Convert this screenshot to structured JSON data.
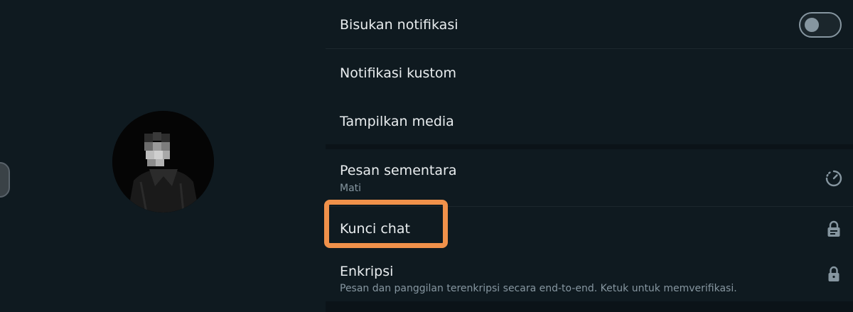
{
  "colors": {
    "background": "#0f1a20",
    "text_primary": "#e9edef",
    "text_secondary": "#8696a0",
    "highlight": "#f0914a"
  },
  "left": {
    "avatar_icon": "profile-photo"
  },
  "settings": {
    "mute_notifications": {
      "label": "Bisukan notifikasi",
      "enabled": false
    },
    "custom_notifications": {
      "label": "Notifikasi kustom"
    },
    "media_visibility": {
      "label": "Tampilkan media"
    },
    "disappearing_messages": {
      "label": "Pesan sementara",
      "value": "Mati",
      "icon": "timer-icon"
    },
    "chat_lock": {
      "label": "Kunci chat",
      "icon": "lock-chat-icon"
    },
    "encryption": {
      "label": "Enkripsi",
      "description": "Pesan dan panggilan terenkripsi secara end-to-end. Ketuk untuk memverifikasi.",
      "icon": "lock-icon"
    }
  }
}
